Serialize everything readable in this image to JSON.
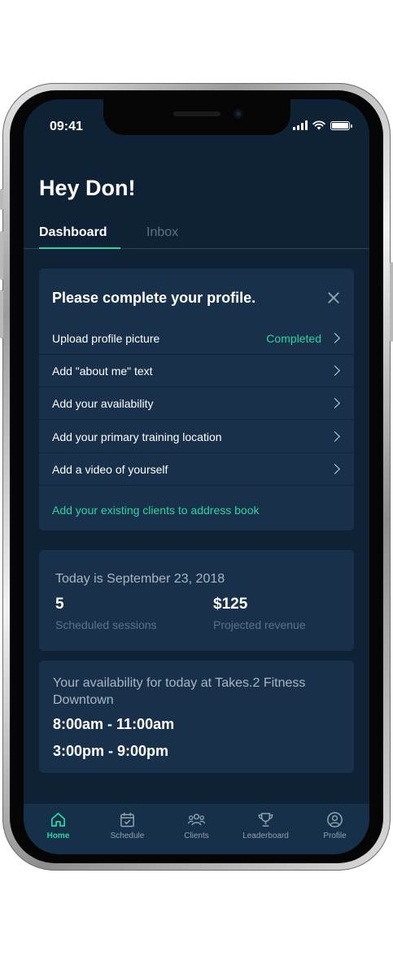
{
  "status_bar": {
    "time": "09:41"
  },
  "greeting": "Hey Don!",
  "tabs": [
    {
      "label": "Dashboard",
      "active": true
    },
    {
      "label": "Inbox",
      "active": false
    }
  ],
  "profile_card": {
    "title": "Please complete your profile.",
    "tasks": [
      {
        "label": "Upload profile picture",
        "status": "Completed"
      },
      {
        "label": "Add \"about me\" text",
        "status": ""
      },
      {
        "label": "Add your availability",
        "status": ""
      },
      {
        "label": "Add your primary training location",
        "status": ""
      },
      {
        "label": "Add a video of yourself",
        "status": ""
      }
    ],
    "link": "Add your existing clients to address book"
  },
  "summary_card": {
    "date_text": "Today is September 23, 2018",
    "sessions_value": "5",
    "sessions_label": "Scheduled sessions",
    "revenue_value": "$125",
    "revenue_label": "Projected revenue"
  },
  "availability_card": {
    "title": "Your availability for today at Takes.2 Fitness Downtown",
    "slots": [
      "8:00am - 11:00am",
      "3:00pm - 9:00pm"
    ]
  },
  "bottom_nav": [
    {
      "label": "Home",
      "icon": "home-icon",
      "active": true
    },
    {
      "label": "Schedule",
      "icon": "calendar-icon",
      "active": false
    },
    {
      "label": "Clients",
      "icon": "users-icon",
      "active": false
    },
    {
      "label": "Leaderboard",
      "icon": "trophy-icon",
      "active": false
    },
    {
      "label": "Profile",
      "icon": "user-circle-icon",
      "active": false
    }
  ],
  "colors": {
    "background": "#0f2235",
    "card": "#18304a",
    "accent": "#2fd2a0",
    "muted_text": "#a8b6c2"
  }
}
